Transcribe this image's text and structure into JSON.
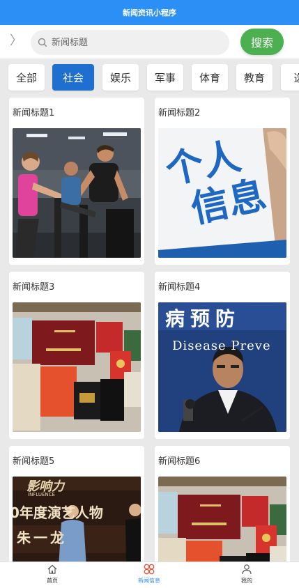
{
  "header": {
    "title": "新闻资讯小程序"
  },
  "search": {
    "placeholder": "新闻标题",
    "button": "搜索"
  },
  "categories": [
    "全部",
    "社会",
    "娱乐",
    "军事",
    "体育",
    "教育",
    "选"
  ],
  "active_category": "社会",
  "news": [
    {
      "title": "新闻标题1",
      "image": "gym-treadmill-photo"
    },
    {
      "title": "新闻标题2",
      "image": "personal-info-sign"
    },
    {
      "title": "新闻标题3",
      "image": "certificates-photo"
    },
    {
      "title": "新闻标题4",
      "image": "press-conference-photo"
    },
    {
      "title": "新闻标题5",
      "image": "stage-event-photo"
    },
    {
      "title": "新闻标题6",
      "image": "certificates-photo"
    }
  ],
  "image_text": {
    "personal_info": [
      "个人",
      "信息"
    ],
    "press_banner_cn": "病预防",
    "press_banner_en": "Disease Preve",
    "stage_brand": "影响力",
    "stage_brand_en": "INFLUENCE",
    "stage_headline": "0年度演艺人物",
    "stage_name": "朱一龙"
  },
  "tabbar": [
    {
      "label": "首页",
      "icon": "home-icon"
    },
    {
      "label": "新闻信息",
      "icon": "news-grid-icon"
    },
    {
      "label": "我的",
      "icon": "user-icon"
    }
  ],
  "colors": {
    "header": "#2b8ff5",
    "search_button": "#4caf50",
    "active_tab": "#1e6fcf"
  }
}
